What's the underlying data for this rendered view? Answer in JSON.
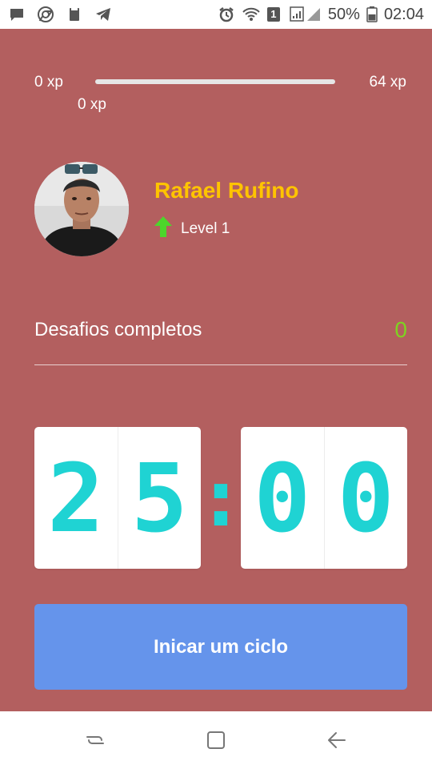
{
  "status_bar": {
    "battery_percent": "50%",
    "time": "02:04",
    "left_icons": [
      "message-icon",
      "chrome-icon",
      "nexo-icon",
      "telegram-icon"
    ],
    "right_icons": [
      "alarm-icon",
      "wifi-icon",
      "sim-1-icon",
      "signal-icon",
      "battery-icon"
    ],
    "sim_label": "1"
  },
  "xp": {
    "min_label": "0 xp",
    "max_label": "64 xp",
    "current_label": "0 xp",
    "progress": 0.0,
    "track_color": "#e6e6e6",
    "fill_color": "#4cd62b"
  },
  "profile": {
    "name": "Rafael Rufino",
    "level_label": "Level 1",
    "level_icon": "level-up-arrow-icon",
    "name_color": "#ffc400"
  },
  "challenges": {
    "label": "Desafios completos",
    "count": "0",
    "count_color": "#7ed321"
  },
  "timer": {
    "minute_tens": "2",
    "minute_ones": "5",
    "separator": ":",
    "second_tens": "0",
    "second_ones": "0",
    "digit_color": "#1fd3d3"
  },
  "start_button": {
    "label": "Inicar um ciclo",
    "color": "#6594eb"
  },
  "nav_bar": {
    "buttons": [
      "recent-apps-icon",
      "home-icon",
      "back-icon"
    ]
  },
  "colors": {
    "background": "#b35f5f"
  }
}
